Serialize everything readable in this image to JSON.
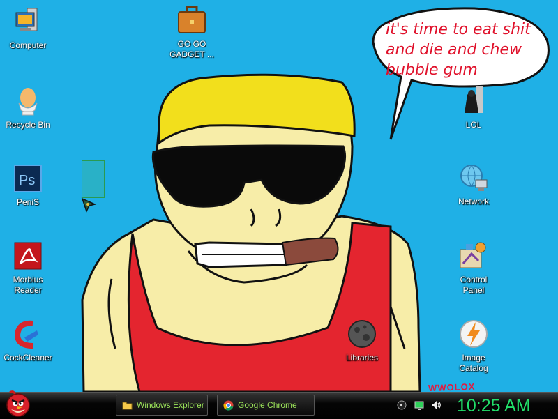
{
  "desktop": {
    "speech_bubble": {
      "line1": "it's time to eat shit",
      "line2": "and die and chew",
      "line3": "bubble gum"
    },
    "icons": [
      {
        "label": "Computer",
        "icon": "computer-icon"
      },
      {
        "label": "GO GO\nGADGET ...",
        "icon": "briefcase-icon"
      },
      {
        "label": "Recycle Bin",
        "icon": "egg-cup-icon"
      },
      {
        "label": "PeniS",
        "icon": "photoshop-icon"
      },
      {
        "label": "Morbius\nReader",
        "icon": "pdf-reader-icon"
      },
      {
        "label": "CockCleaner",
        "icon": "ccleaner-icon"
      },
      {
        "label": "LOL",
        "icon": "dark-figure-icon"
      },
      {
        "label": "Network",
        "icon": "network-globe-icon"
      },
      {
        "label": "Control\nPanel",
        "icon": "control-panel-icon"
      },
      {
        "label": "Libraries",
        "icon": "moon-rock-icon"
      },
      {
        "label": "Image\nCatalog",
        "icon": "lightning-icon"
      }
    ],
    "graffiti_text": "WWOLOX"
  },
  "taskbar": {
    "start_icon": "angry-bird-icon",
    "buttons": [
      {
        "label": "Windows Explorer",
        "icon": "folder-icon"
      },
      {
        "label": "Google Chrome",
        "icon": "chrome-icon"
      }
    ],
    "tray": [
      "network-tray-icon",
      "monitor-tray-icon",
      "volume-icon"
    ],
    "clock": "10:25 AM"
  },
  "colors": {
    "desktop_bg": "#1fb0e6",
    "bubble_text": "#e0102a",
    "taskbar_text": "#9de65a",
    "clock": "#21e06a"
  }
}
